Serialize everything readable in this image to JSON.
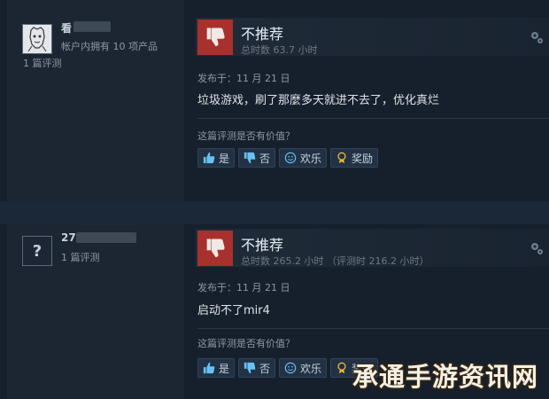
{
  "reviews": [
    {
      "persona": "看",
      "products_owned": "帐户内拥有 10 项产品",
      "reviews_count": "1 篇评测",
      "verdict": "不推荐",
      "playtime": "总时数 63.7 小时",
      "posted": "发布于：11 月 21 日",
      "content": "垃圾游戏，刷了那麼多天就进不去了，优化真烂",
      "helpful_question": "这篇评测是否有价值？",
      "buttons": {
        "yes": "是",
        "no": "否",
        "funny": "欢乐",
        "award": "奖励"
      }
    },
    {
      "persona": "27",
      "reviews_count": "1 篇评测",
      "avatar_placeholder": "?",
      "verdict": "不推荐",
      "playtime": "总时数 265.2 小时 （评测时 216.2 小时）",
      "posted": "发布于：11 月 21 日",
      "content": "启动不了mir4",
      "helpful_question": "这篇评测是否有价值？",
      "buttons": {
        "yes": "是",
        "no": "否",
        "funny": "欢乐",
        "award": "奖励"
      }
    }
  ],
  "watermark": "承通手游资讯网",
  "colors": {
    "background": "#1b2838",
    "thumb_down_bg": "#a8312d",
    "button_bg": "#223244"
  },
  "icons": [
    "thumbs-down-icon",
    "gear-icon",
    "thumbs-up-icon",
    "smiley-icon",
    "award-icon"
  ]
}
